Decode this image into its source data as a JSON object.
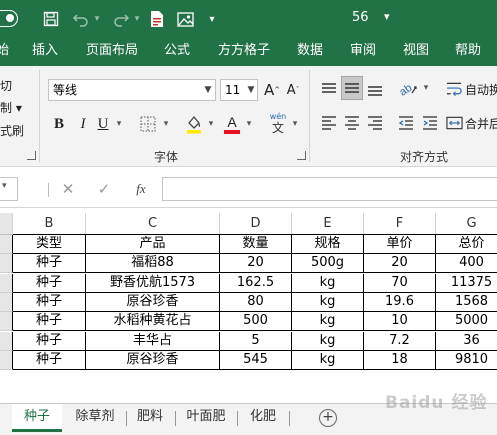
{
  "titlebar": {
    "title": "56",
    "icons": [
      "autosave-toggle",
      "save-icon",
      "undo-icon",
      "redo-icon",
      "document-icon",
      "picture-icon",
      "customize-dropdown-icon"
    ]
  },
  "ribbon_tabs": [
    "始",
    "插入",
    "页面布局",
    "公式",
    "方方格子",
    "数据",
    "审阅",
    "视图",
    "帮助"
  ],
  "ribbon": {
    "clipboard_fragments": [
      "切",
      "制 ▾",
      "式刷"
    ],
    "font_name": "等线",
    "font_size": "11",
    "font_group_label": "字体",
    "align_group_label": "对齐方式",
    "wrap_text": "自动换",
    "merge_center": "合并后",
    "bold": "B",
    "italic": "I",
    "underline": "U",
    "increase_font": "A",
    "decrease_font": "A",
    "wen": "wén",
    "wen_char": "文"
  },
  "formula_bar": {
    "fx": "fx"
  },
  "columns": [
    "B",
    "C",
    "D",
    "E",
    "F",
    "G"
  ],
  "table": {
    "headers": [
      "类型",
      "产品",
      "数量",
      "规格",
      "单价",
      "总价"
    ],
    "rows": [
      [
        "种子",
        "福稻88",
        "20",
        "500g",
        "20",
        "400"
      ],
      [
        "种子",
        "野香优航1573",
        "162.5",
        "kg",
        "70",
        "11375"
      ],
      [
        "种子",
        "原谷珍香",
        "80",
        "kg",
        "19.6",
        "1568"
      ],
      [
        "种子",
        "水稻种黄花占",
        "500",
        "kg",
        "10",
        "5000"
      ],
      [
        "种子",
        "丰华占",
        "5",
        "kg",
        "7.2",
        "36"
      ],
      [
        "种子",
        "原谷珍香",
        "545",
        "kg",
        "18",
        "9810"
      ]
    ]
  },
  "sheet_tabs": [
    "种子",
    "除草剂",
    "肥料",
    "叶面肥",
    "化肥"
  ],
  "active_sheet": "种子",
  "watermark": "Baidu 经验",
  "colors": {
    "excel_green": "#217346",
    "font_color_red": "#e81123",
    "highlight_yellow": "#ffeb00"
  }
}
